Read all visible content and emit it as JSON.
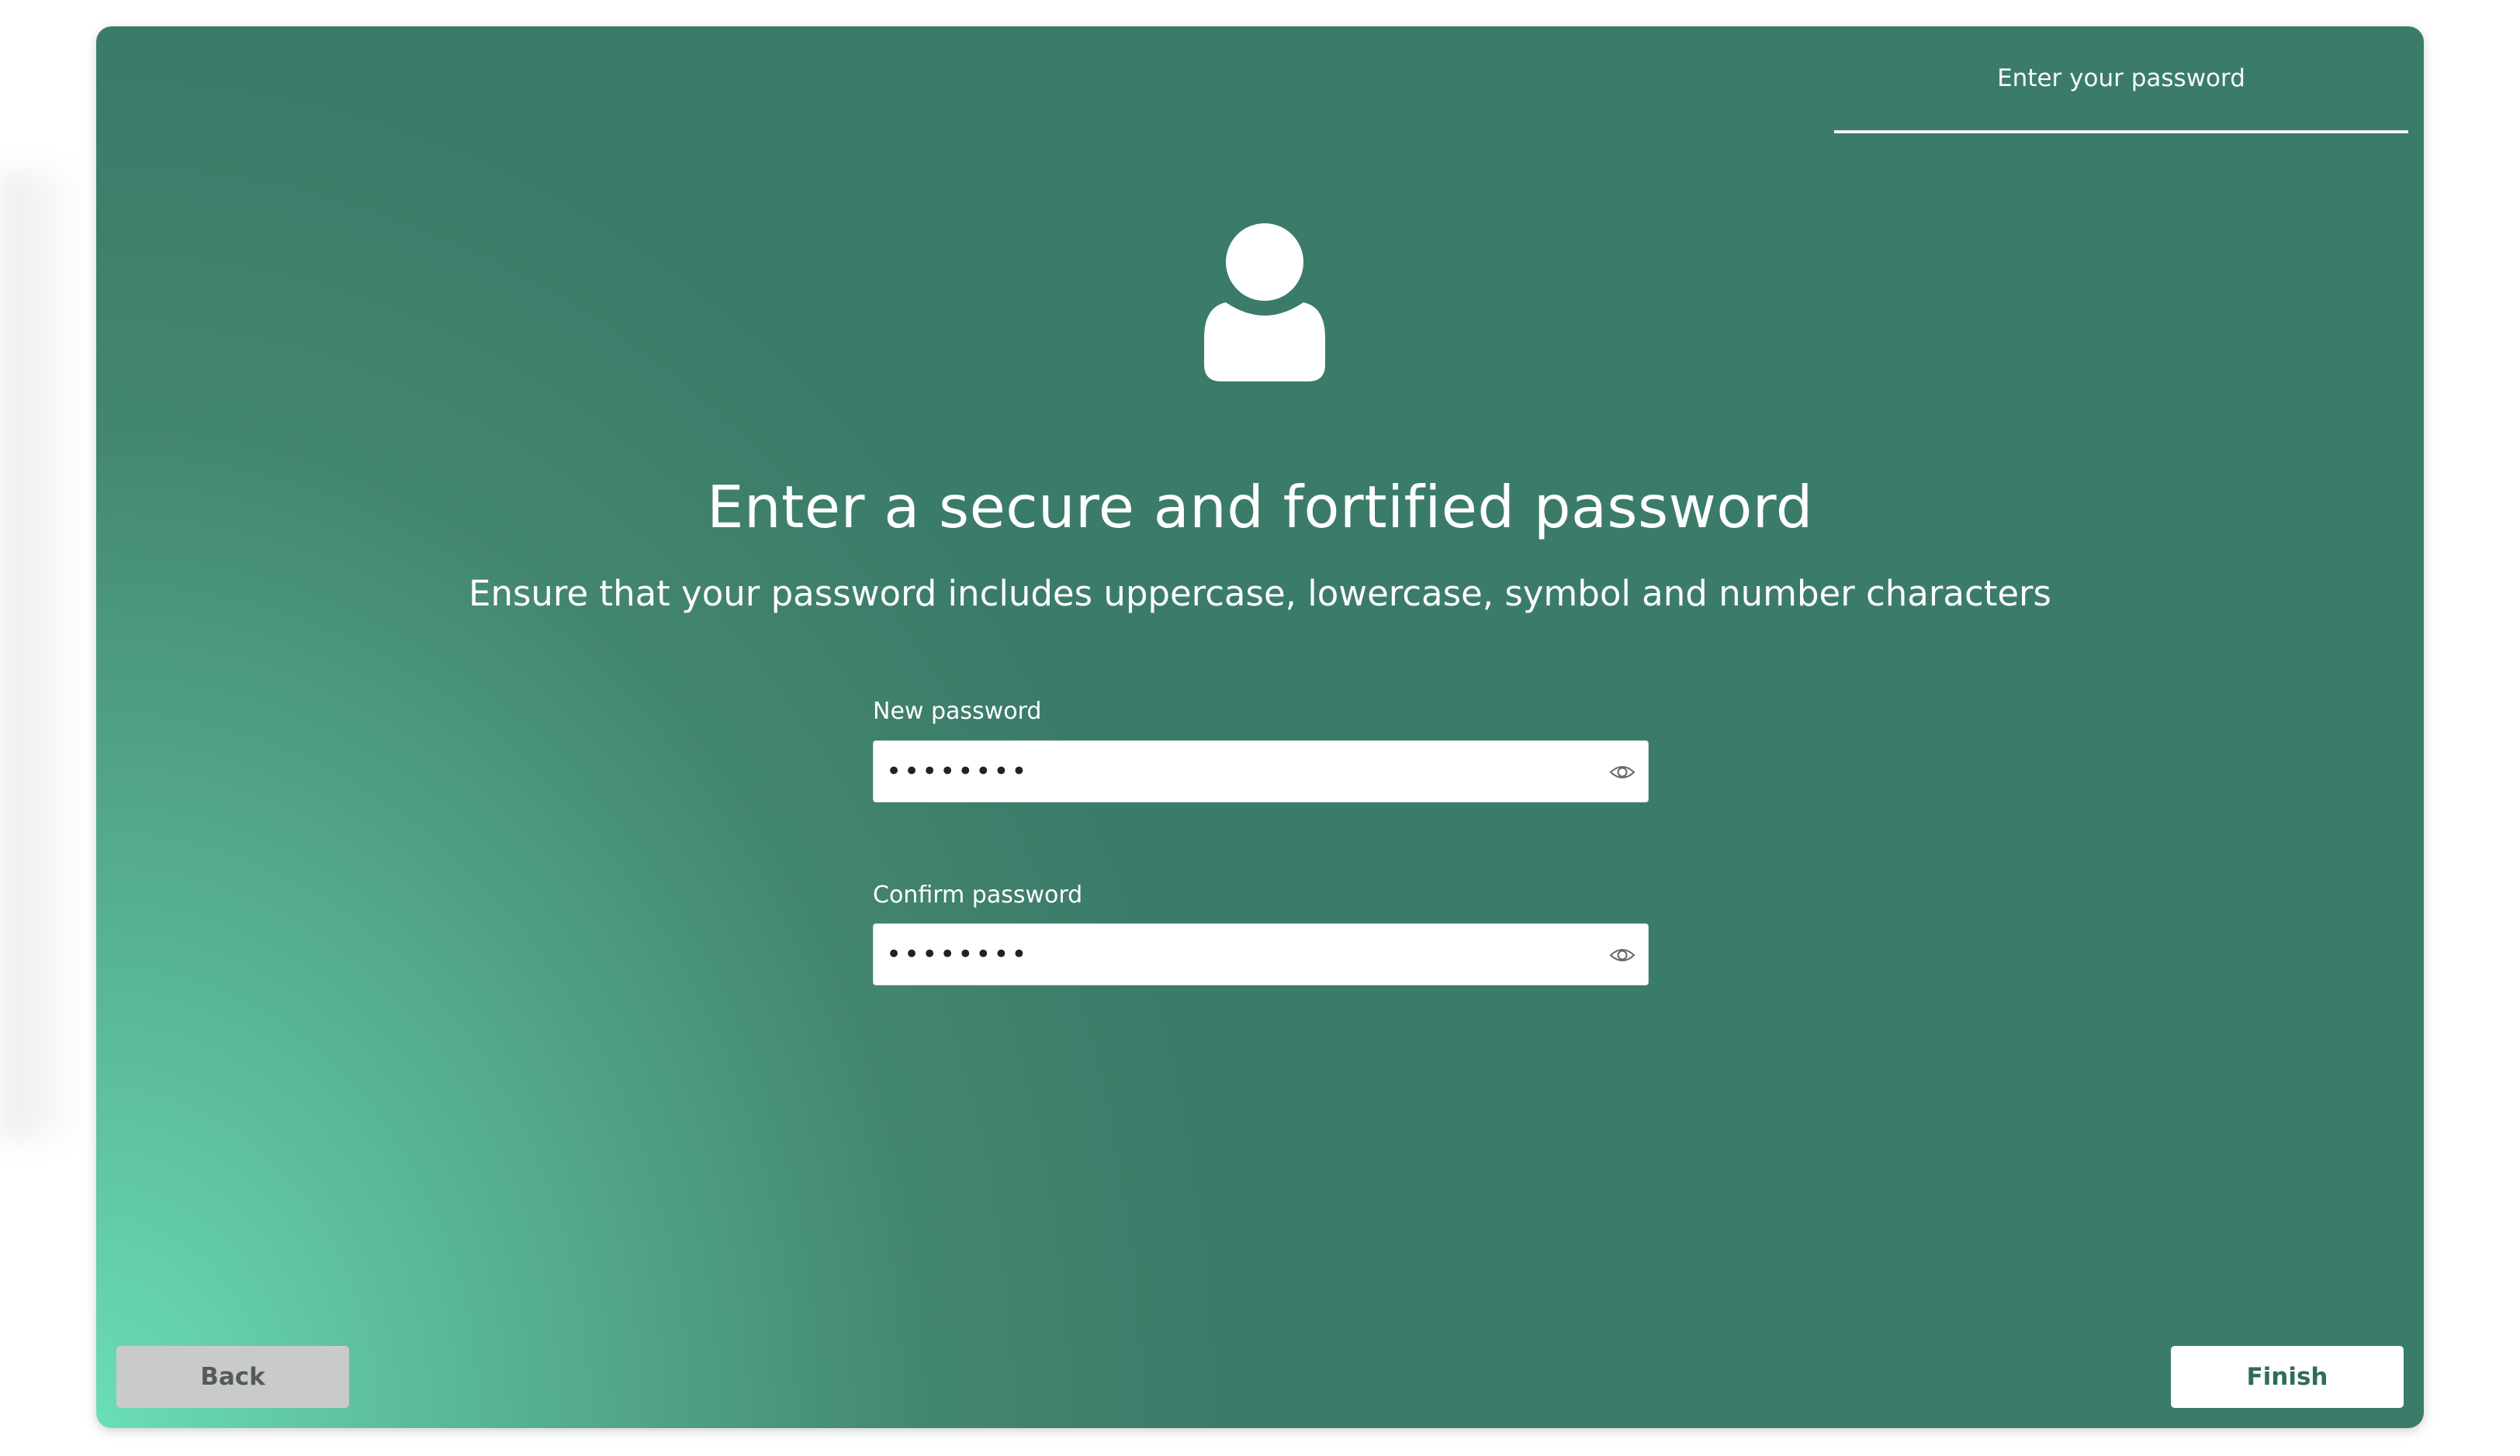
{
  "stepper": {
    "current_step": "Enter your password"
  },
  "header": {
    "title": "Enter a secure and fortified password",
    "subtitle": "Ensure that your password includes uppercase, lowercase, symbol and number characters"
  },
  "form": {
    "new_password": {
      "label": "New password",
      "value": "••••••••",
      "icon": "eye-icon"
    },
    "confirm_password": {
      "label": "Confirm password",
      "value": "••••••••",
      "icon": "eye-icon"
    }
  },
  "footer": {
    "back_label": "Back",
    "finish_label": "Finish"
  },
  "colors": {
    "background": "#3b7b6a",
    "gradient_light": "#6bddb9",
    "finish_text": "#2f6c5c",
    "back_button": "#c9cbca"
  },
  "icons": {
    "avatar": "user-icon"
  }
}
